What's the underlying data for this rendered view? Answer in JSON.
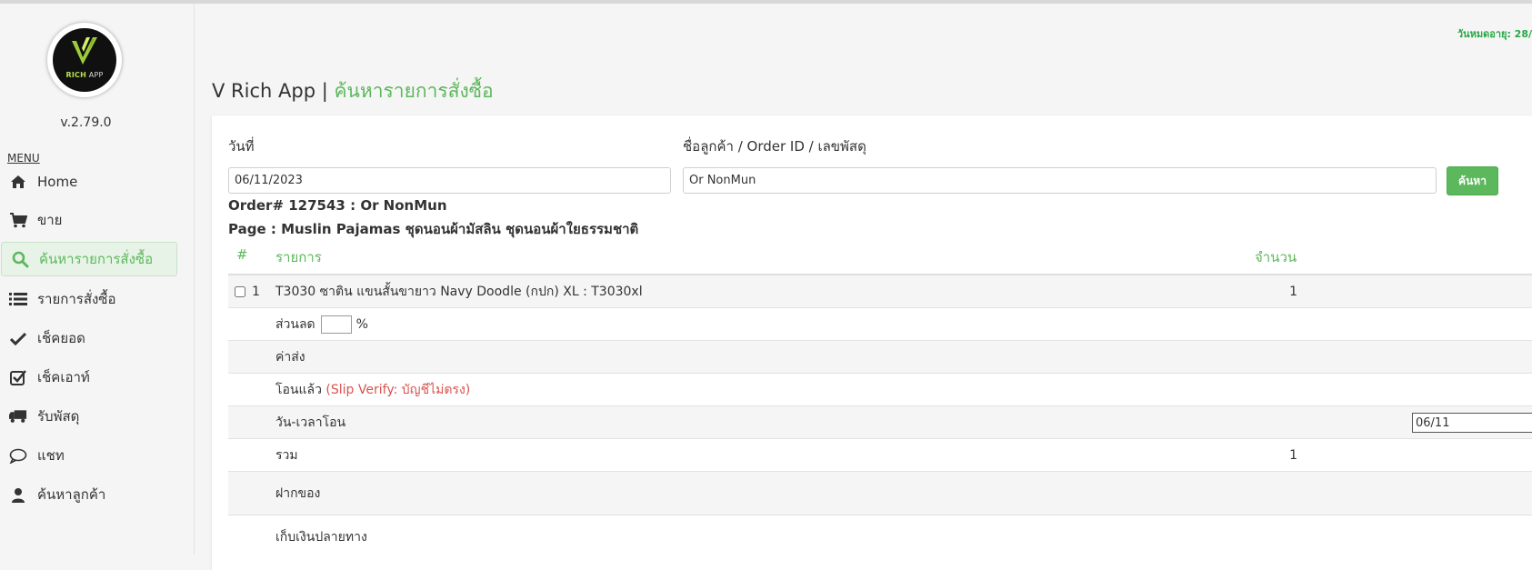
{
  "app": {
    "version": "v.2.79.0",
    "menu_label": "MENU",
    "logo_text": "RICH APP",
    "expire_text": "วันหมดอายุ: 28/"
  },
  "sidebar": {
    "items": [
      {
        "label": "Home",
        "icon": "home-icon"
      },
      {
        "label": "ขาย",
        "icon": "cart-icon"
      },
      {
        "label": "ค้นหารายการสั่งซื้อ",
        "icon": "search-icon",
        "active": true
      },
      {
        "label": "รายการสั่งซื้อ",
        "icon": "list-icon"
      },
      {
        "label": "เช็คยอด",
        "icon": "check-icon"
      },
      {
        "label": "เช็คเอาท์",
        "icon": "check-square-icon"
      },
      {
        "label": "รับพัสดุ",
        "icon": "truck-icon"
      },
      {
        "label": "แชท",
        "icon": "chat-icon"
      },
      {
        "label": "ค้นหาลูกค้า",
        "icon": "user-icon"
      }
    ]
  },
  "header": {
    "title_prefix": "V Rich App | ",
    "title_highlight": "ค้นหารายการสั่งซื้อ"
  },
  "search": {
    "date_label": "วันที่",
    "date_value": "06/11/2023",
    "query_label": "ชื่อลูกค้า / Order ID / เลขพัสดุ",
    "query_value": "Or NonMun",
    "button_label": "ค้นหา"
  },
  "order": {
    "order_line": "Order# 127543 : Or NonMun",
    "page_line": "Page : Muslin Pajamas ชุดนอนผ้ามัสลิน ชุดนอนผ้าใยธรรมชาติ"
  },
  "table": {
    "headers": {
      "index": "#",
      "item": "รายการ",
      "qty": "จำนวน"
    },
    "item_row": {
      "index": "1",
      "name": "T3030 ซาติน แขนสั้นขายาว Navy Doodle (กปก) XL : T3030xl",
      "qty": "1"
    },
    "discount_label": "ส่วนลด",
    "discount_unit": "%",
    "shipping_label": "ค่าส่ง",
    "paid_label": "โอนแล้ว",
    "slip_verify": "(Slip Verify: บัญชีไม่ตรง)",
    "transfer_time_label": "วัน-เวลาโอน",
    "transfer_date_value": "06/11",
    "total_label": "รวม",
    "total_qty": "1",
    "deposit_label": "ฝากของ",
    "cod_label": "เก็บเงินปลายทาง"
  },
  "colors": {
    "accent_green": "#5cb85c",
    "expire_green": "#28a745",
    "slip_red": "#d9534f"
  }
}
